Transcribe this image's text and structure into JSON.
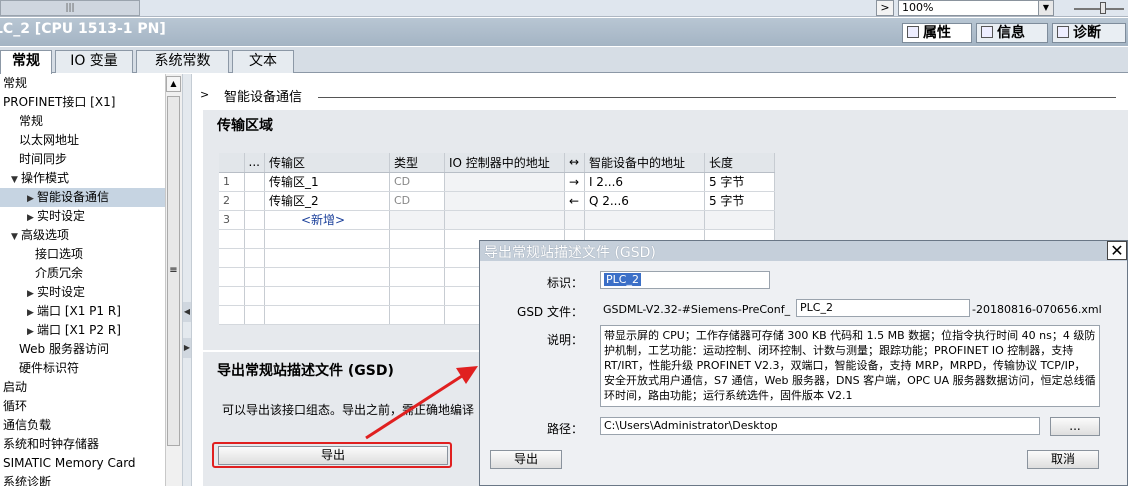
{
  "toolbar": {
    "scroll_glyph": "|||",
    "zoom_prev": ">",
    "zoom_value": "100%",
    "zoom_dropdown": "▼"
  },
  "window": {
    "title": "LC_2 [CPU 1513-1 PN]",
    "right_tabs": [
      "属性",
      "信息",
      "诊断"
    ]
  },
  "tabs": [
    "常规",
    "IO 变量",
    "系统常数",
    "文本"
  ],
  "tree": [
    {
      "label": "常规",
      "indent": 0,
      "arrow": ""
    },
    {
      "label": "PROFINET接口 [X1]",
      "indent": 0,
      "arrow": ""
    },
    {
      "label": "常规",
      "indent": 2,
      "arrow": ""
    },
    {
      "label": "以太网地址",
      "indent": 2,
      "arrow": ""
    },
    {
      "label": "时间同步",
      "indent": 2,
      "arrow": ""
    },
    {
      "label": "操作模式",
      "indent": 1,
      "arrow": "▼"
    },
    {
      "label": "智能设备通信",
      "indent": 3,
      "arrow": "▶"
    },
    {
      "label": "实时设定",
      "indent": 3,
      "arrow": "▶"
    },
    {
      "label": "高级选项",
      "indent": 1,
      "arrow": "▼"
    },
    {
      "label": "接口选项",
      "indent": 4,
      "arrow": ""
    },
    {
      "label": "介质冗余",
      "indent": 4,
      "arrow": ""
    },
    {
      "label": "实时设定",
      "indent": 3,
      "arrow": "▶"
    },
    {
      "label": "端口 [X1 P1 R]",
      "indent": 3,
      "arrow": "▶"
    },
    {
      "label": "端口 [X1 P2 R]",
      "indent": 3,
      "arrow": "▶"
    },
    {
      "label": "Web 服务器访问",
      "indent": 2,
      "arrow": ""
    },
    {
      "label": "硬件标识符",
      "indent": 2,
      "arrow": ""
    },
    {
      "label": "启动",
      "indent": 0,
      "arrow": ""
    },
    {
      "label": "循环",
      "indent": 0,
      "arrow": ""
    },
    {
      "label": "通信负载",
      "indent": 0,
      "arrow": ""
    },
    {
      "label": "系统和时钟存储器",
      "indent": 0,
      "arrow": ""
    },
    {
      "label": "SIMATIC Memory Card",
      "indent": 0,
      "arrow": ""
    },
    {
      "label": "系统诊断",
      "indent": 0,
      "arrow": ""
    }
  ],
  "tree_selected_index": 6,
  "section": {
    "arrow": ">",
    "title": "智能设备通信"
  },
  "transfer": {
    "title": "传输区域",
    "headers": [
      "...",
      "传输区",
      "类型",
      "IO 控制器中的地址",
      "↔",
      "智能设备中的地址",
      "长度"
    ],
    "rows": [
      {
        "idx": "1",
        "name": "传输区_1",
        "type": "CD",
        "ctrl_addr": "",
        "dir": "→",
        "dev_addr": "I 2...6",
        "len": "5 字节"
      },
      {
        "idx": "2",
        "name": "传输区_2",
        "type": "CD",
        "ctrl_addr": "",
        "dir": "←",
        "dev_addr": "Q 2...6",
        "len": "5 字节"
      },
      {
        "idx": "3",
        "name": "<新增>",
        "type": "",
        "ctrl_addr": "",
        "dir": "",
        "dev_addr": "",
        "len": ""
      }
    ]
  },
  "gsd_section": {
    "title": "导出常规站描述文件 (GSD)",
    "desc": "可以导出该接口组态。导出之前，需正确地编译",
    "export_label": "导出"
  },
  "dialog": {
    "title": "导出常规站描述文件 (GSD)",
    "close": "✕",
    "id_label": "标识：",
    "id_value": "PLC_2",
    "gsd_label": "GSD 文件：",
    "gsd_prefix": "GSDML-V2.32-#Siemens-PreConf_",
    "gsd_name": "PLC_2",
    "gsd_suffix": "-20180816-070656.xml",
    "desc_label": "说明：",
    "desc_value": "带显示屏的 CPU；工作存储器可存储 300 KB 代码和 1.5 MB 数据；位指令执行时间 40 ns；4 级防护机制，工艺功能：运动控制、闭环控制、计数与测量；跟踪功能；PROFINET IO 控制器，支持 RT/IRT，性能升级 PROFINET V2.3，双端口，智能设备，支持 MRP，MRPD，传输协议 TCP/IP，安全开放式用户通信，S7 通信，Web 服务器，DNS 客户端，OPC UA 服务器数据访问，恒定总线循环时间，路由功能；运行系统选件，固件版本 V2.1",
    "path_label": "路径：",
    "path_value": "C:\\Users\\Administrator\\Desktop",
    "browse_label": "...",
    "export_label": "导出",
    "cancel_label": "取消"
  },
  "annotation_color": "#e02020"
}
